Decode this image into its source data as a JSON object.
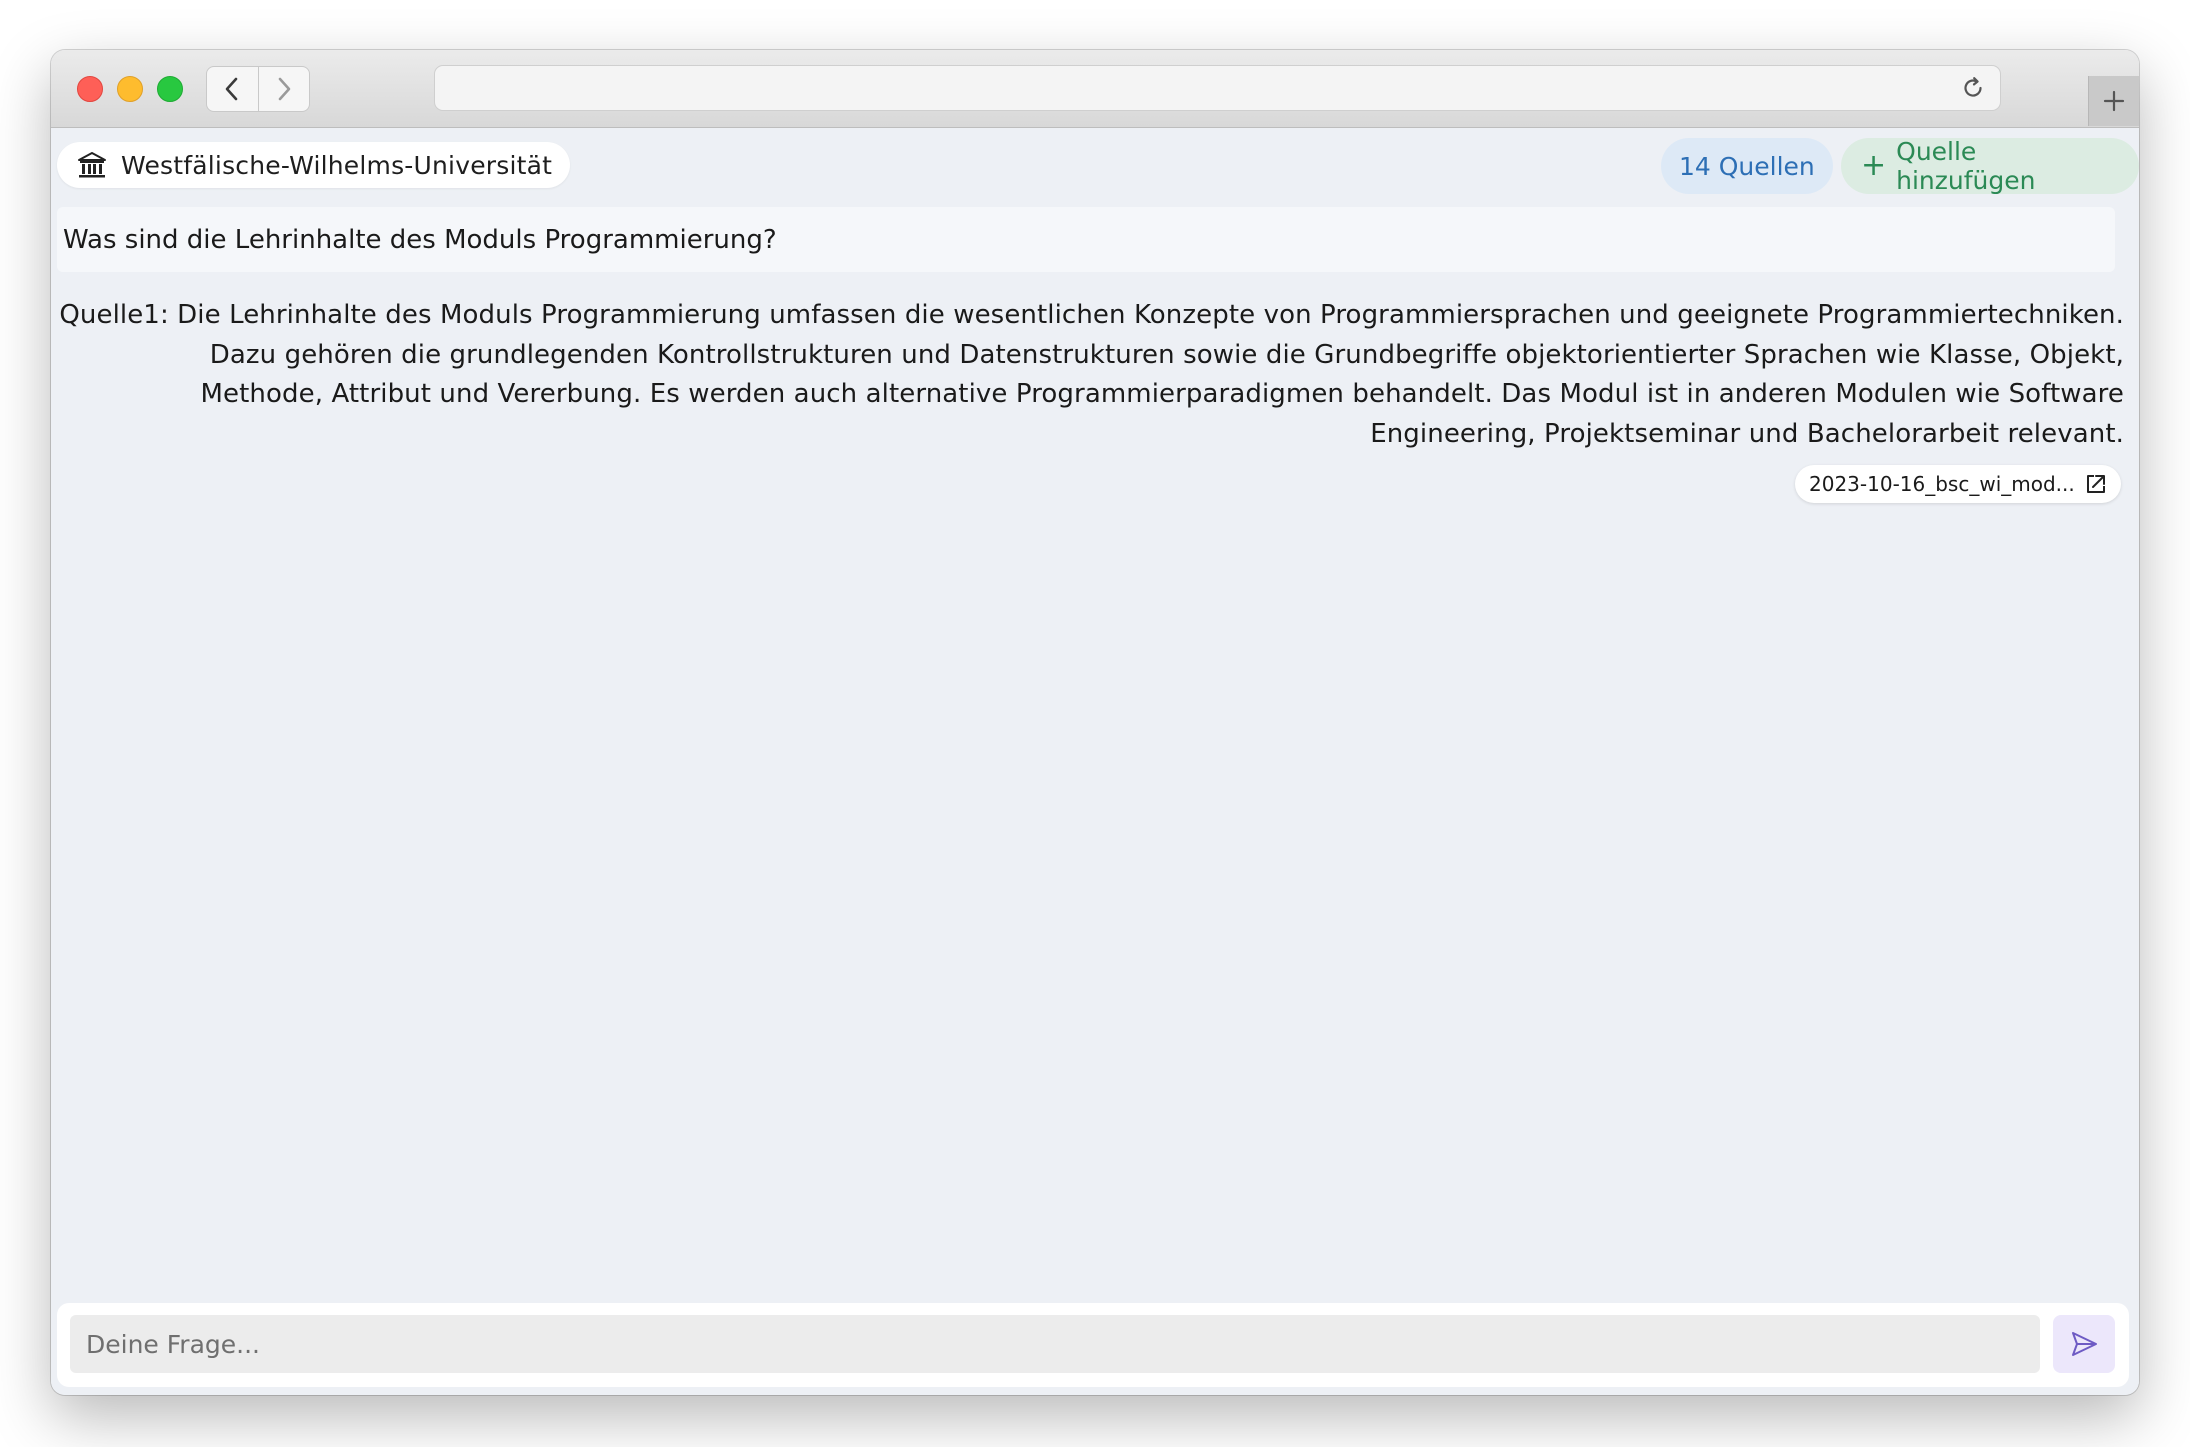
{
  "browser": {
    "url": "",
    "icons": {
      "back": "chevron-left-icon",
      "forward": "chevron-right-icon",
      "reload": "reload-icon",
      "new_tab": "plus-icon"
    }
  },
  "header": {
    "institution_icon": "university-building-icon",
    "institution_label": "Westfälische-Wilhelms-Universität",
    "sources_label": "14 Quellen",
    "add_source_plus": "+",
    "add_source_label": "Quelle hinzufügen"
  },
  "chat": {
    "question": "Was sind die Lehrinhalte des Moduls Programmierung?",
    "answer_lines": [
      "Quelle1: Die Lehrinhalte des Moduls Programmierung umfassen die wesentlichen Konzepte von Programmiersprachen und geeignete Programmiertechniken.",
      "Dazu gehören die grundlegenden Kontrollstrukturen und Datenstrukturen sowie die Grundbegriffe objektorientierter Sprachen wie Klasse, Objekt,",
      "Methode, Attribut und Vererbung. Es werden auch alternative Programmierparadigmen behandelt. Das Modul ist in anderen Modulen wie Software",
      "Engineering, Projektseminar und Bachelorarbeit relevant."
    ],
    "source_chip_label": "2023-10-16_bsc_wi_mod...",
    "source_chip_icon": "open-external-icon"
  },
  "composer": {
    "placeholder": "Deine Frage...",
    "value": "",
    "send_icon": "send-icon"
  },
  "colors": {
    "background": "#edf0f5",
    "sources_pill_bg": "#dde9f6",
    "sources_pill_text": "#2d6fb5",
    "add_pill_bg": "#dcece2",
    "add_pill_text": "#2b8a55",
    "send_bg": "#ece7fb",
    "send_icon": "#6e5bc4"
  }
}
